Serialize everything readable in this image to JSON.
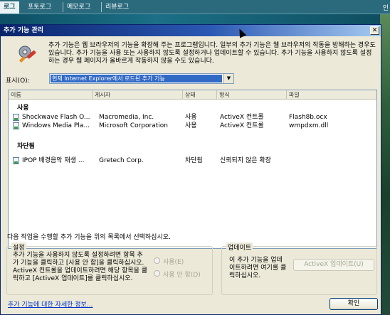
{
  "web_nav": {
    "tabs": [
      "로그",
      "포토로그",
      "메모로그",
      "리뷰로그"
    ],
    "right_text": "인"
  },
  "dialog": {
    "title": "추가 기능 관리",
    "close_label": "✕",
    "intro": "추가 기능은 웹 브라우저의 기능을 확장해 주는 프로그램입니다. 일부의 추가 기능은 웹 브라우저의 작동을 방해하는 경우도 있습니다. 추가 기능을 사용 또는 사용하지 않도록 설정하거나 업데이트할 수 있습니다. 추가 기능을 사용하지 않도록 설정하는 경우 웹 페이지가 올바르게 작동하지 않을 수도 있습니다.",
    "show_label": "표시(O):",
    "show_value": "현재 Internet Explorer에서 로드된 추가 기능",
    "columns": [
      "이름",
      "게시자",
      "상태",
      "형식",
      "파일"
    ],
    "groups": [
      {
        "label": "사용",
        "rows": [
          {
            "name": "Shockwave Flash O...",
            "publisher": "Macromedia, Inc.",
            "status": "사용",
            "type": "ActiveX 컨트롤",
            "file": "Flash8b.ocx"
          },
          {
            "name": "Windows Media Pla...",
            "publisher": "Microsoft Corporation",
            "status": "사용",
            "type": "ActiveX 컨트롤",
            "file": "wmpdxm.dll"
          }
        ]
      },
      {
        "label": "차단됨",
        "rows": [
          {
            "name": "IPOP 배경음악 재생 ...",
            "publisher": "Gretech Corp.",
            "status": "차단됨",
            "type": "신뢰되지 않은 확장",
            "file": ""
          }
        ]
      }
    ],
    "hint": "다음 작업을 수행할 추가 기능을 위의 목록에서 선택하십시오.",
    "settings": {
      "title": "설정",
      "text": "추가 기능을 사용하지 않도록 설정하려면 항목 추가 기능을 클릭하고 [사용 안 함]을 클릭하십시오. ActiveX 컨트롤을 업데이트하려면 해당 항목을 클릭하고 [ActiveX 업데이트]를 클릭하십시오.",
      "radio_enable": "사용(E)",
      "radio_disable": "사용 안 함(D)"
    },
    "update": {
      "title": "업데이트",
      "text": "이 추가 기능을 업데이트하려면 여기를 클릭하십시오.",
      "button": "ActiveX 업데이트(U)"
    },
    "more_info_link": "추가 기능에 대한 자세한 정보...",
    "ok_button": "확인"
  }
}
